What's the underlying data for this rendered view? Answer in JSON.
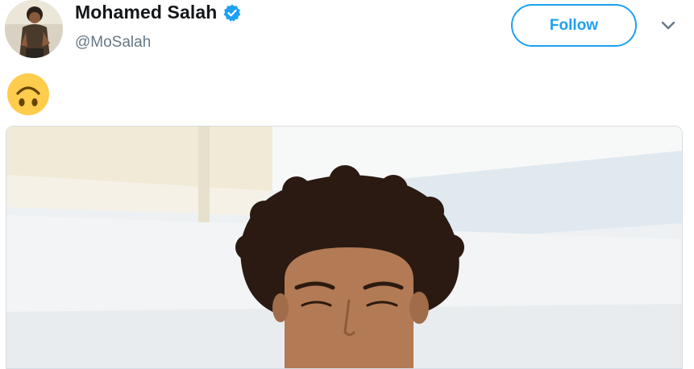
{
  "tweet": {
    "author": {
      "display_name": "Mohamed Salah",
      "handle": "@MoSalah",
      "verified": true,
      "avatar_icon": "profile-photo"
    },
    "follow_label": "Follow",
    "more_menu_icon": "chevron-down-icon",
    "text_emoji_icon": "upside-down-face-emoji",
    "media": {
      "type": "photo",
      "icon": "photo-person-smiling"
    },
    "colors": {
      "accent": "#1da1f2",
      "name": "#14171a",
      "secondary": "#657786"
    }
  }
}
